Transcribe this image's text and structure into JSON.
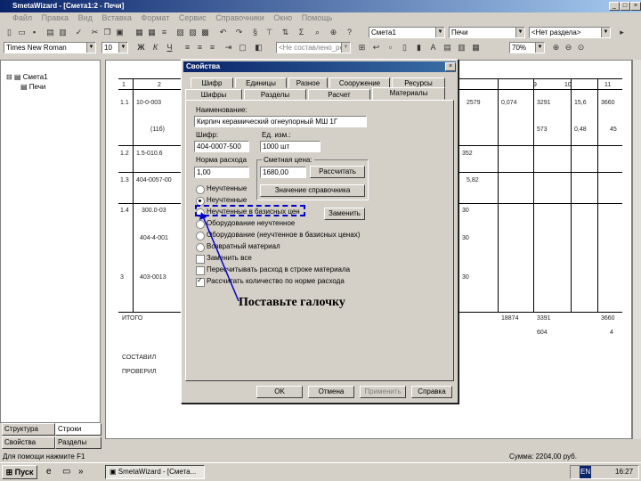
{
  "window": {
    "title": "SmetaWizard - [Смета1:2 - Печи]"
  },
  "menu": [
    "Файл",
    "Правка",
    "Вид",
    "Вставка",
    "Формат",
    "Сервис",
    "Справочники",
    "Окно",
    "Помощь"
  ],
  "toolbar2": {
    "estimate": "Смета1",
    "section": "Печи",
    "no_section": "<Нет раздела>"
  },
  "toolbar3": {
    "font": "Times New Roman",
    "size": "10",
    "style": "<Не составлено_ре>",
    "zoom": "70%"
  },
  "tree": {
    "root": "Смета1",
    "child": "Печи"
  },
  "left_tabs": [
    "Структура",
    "Строки",
    "Свойства",
    "Разделы"
  ],
  "status": {
    "left": "Для помощи нажмите F1",
    "right": "Сумма: 2204,00 руб."
  },
  "taskbar": {
    "start": "Пуск",
    "task": "SmetaWizard - [Смета...",
    "lang": "EN",
    "time": "16:27"
  },
  "sheet": {
    "rows": [
      {
        "cols": [
          "1",
          "2",
          "",
          "",
          "",
          "",
          "",
          "",
          "",
          "9",
          "10",
          "11"
        ]
      },
      {
        "cols": [
          "1.1",
          "10-0-003",
          "",
          "",
          "",
          "",
          "2579",
          "0,074",
          "",
          "3291",
          "15,6",
          "3660"
        ]
      },
      {
        "cols": [
          "",
          "(11б)",
          "",
          "",
          "",
          "",
          "",
          "",
          "",
          "573",
          "0,48",
          "45"
        ]
      },
      {
        "cols": [
          "1.2",
          "1.5-010.6",
          "",
          "",
          "",
          "",
          "352",
          "",
          "",
          "",
          "",
          ""
        ]
      },
      {
        "cols": [
          "1.3",
          "404-0057-00",
          "",
          "",
          "",
          "",
          "",
          "5,82",
          "",
          "",
          "",
          ""
        ]
      },
      {
        "cols": [
          "1.4",
          "300.0-03",
          "",
          "",
          "",
          "",
          "30",
          "",
          "",
          "",
          "",
          ""
        ]
      },
      {
        "cols": [
          "",
          "404-4-001",
          "",
          "",
          "",
          "",
          "30",
          "",
          "",
          "",
          "",
          ""
        ]
      },
      {
        "cols": [
          "3",
          "403-0013",
          "",
          "",
          "",
          "",
          "30",
          "",
          "",
          "",
          "",
          ""
        ]
      }
    ],
    "total_label": "ИТОГО",
    "total_vals": [
      "18874",
      "3391",
      "",
      "3660"
    ],
    "total_sub": [
      "604",
      "",
      "4"
    ],
    "footer1": "СОСТАВИЛ",
    "footer2": "ПРОВЕРИЛ"
  },
  "dialog": {
    "title": "Свойства",
    "tabs_row1": [
      "Шифр",
      "Единицы",
      "Разное",
      "Сооружение",
      "Ресурсы"
    ],
    "tabs_row2": [
      "Шифры",
      "Разделы",
      "Расчет",
      "Материалы"
    ],
    "name_label": "Наименование:",
    "name_value": "Кирпич керамический огнеупорный МШ 1Г",
    "code_label": "Шифр:",
    "code_value": "404-0007-500",
    "unit_label": "Ед. изм.:",
    "unit_value": "1000 шт",
    "norm_label": "Норма расхода",
    "norm_value": "1,00",
    "price_label": "Сметная цена:",
    "price_value": "1680,00",
    "calc_btn": "Рассчитать",
    "ref_btn": "Значение справочника",
    "options": [
      {
        "label": "Неучтенные",
        "type": "radio",
        "on": false
      },
      {
        "label": "Неучтенные",
        "type": "radio",
        "on": true
      },
      {
        "label": "Неучтенные в базисных цен",
        "type": "radio",
        "on": false
      },
      {
        "label": "Оборудование неучтенное",
        "type": "radio",
        "on": false
      },
      {
        "label": "Оборудование (неучтенное в базисных ценах)",
        "type": "radio",
        "on": false
      },
      {
        "label": "Возвратный материал",
        "type": "radio",
        "on": false
      },
      {
        "label": "Заменить все",
        "type": "check",
        "on": false
      },
      {
        "label": "Пересчитывать расход в строке материала",
        "type": "check",
        "on": false
      },
      {
        "label": "Рассчитать количество по норме расхода",
        "type": "check",
        "on": true
      }
    ],
    "change_btn": "Заменить",
    "ok": "OK",
    "cancel": "Отмена",
    "apply": "Применить",
    "help": "Справка"
  },
  "callout": "Поставьте галочку",
  "colors": {
    "title_start": "#0a246a",
    "title_end": "#a6caf0",
    "highlight": "#0000cc"
  }
}
